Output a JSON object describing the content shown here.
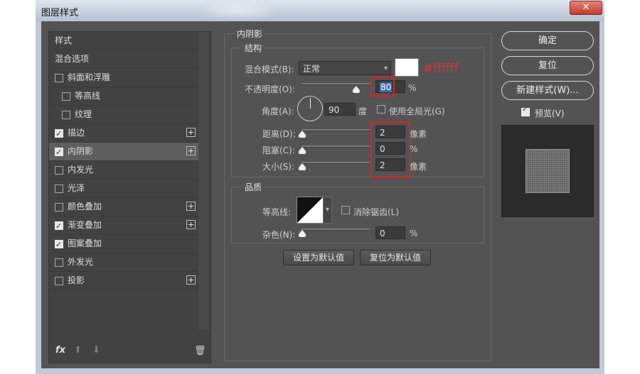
{
  "window": {
    "title": "图层样式",
    "close_glyph": "✕"
  },
  "style_list": {
    "items": [
      {
        "label": "样式",
        "kind": "top",
        "checkbox": false,
        "checked": false,
        "plus": false,
        "active": false
      },
      {
        "label": "混合选项",
        "kind": "top",
        "checkbox": false,
        "checked": false,
        "plus": false,
        "active": false
      },
      {
        "label": "斜面和浮雕",
        "kind": "item",
        "checkbox": true,
        "checked": false,
        "plus": false,
        "active": false
      },
      {
        "label": "等高线",
        "kind": "sub",
        "checkbox": true,
        "checked": false,
        "plus": false,
        "active": false
      },
      {
        "label": "纹理",
        "kind": "sub",
        "checkbox": true,
        "checked": false,
        "plus": false,
        "active": false
      },
      {
        "label": "描边",
        "kind": "item",
        "checkbox": true,
        "checked": true,
        "plus": true,
        "active": false
      },
      {
        "label": "内阴影",
        "kind": "item",
        "checkbox": true,
        "checked": true,
        "plus": true,
        "active": true
      },
      {
        "label": "内发光",
        "kind": "item",
        "checkbox": true,
        "checked": false,
        "plus": false,
        "active": false
      },
      {
        "label": "光泽",
        "kind": "item",
        "checkbox": true,
        "checked": false,
        "plus": false,
        "active": false
      },
      {
        "label": "颜色叠加",
        "kind": "item",
        "checkbox": true,
        "checked": false,
        "plus": true,
        "active": false
      },
      {
        "label": "渐变叠加",
        "kind": "item",
        "checkbox": true,
        "checked": true,
        "plus": true,
        "active": false
      },
      {
        "label": "图案叠加",
        "kind": "item",
        "checkbox": true,
        "checked": true,
        "plus": false,
        "active": false
      },
      {
        "label": "外发光",
        "kind": "item",
        "checkbox": true,
        "checked": false,
        "plus": false,
        "active": false
      },
      {
        "label": "投影",
        "kind": "item",
        "checkbox": true,
        "checked": false,
        "plus": true,
        "active": false
      }
    ],
    "footer": {
      "fx": "fx",
      "up": "⬆",
      "down": "⬇",
      "trash": "🗑"
    }
  },
  "inner_shadow": {
    "section_title": "内阴影",
    "structure": {
      "title": "结构",
      "blend_mode_label": "混合模式(B):",
      "blend_mode_value": "正常",
      "color_annotation": "#ffffff",
      "swatch_color": "#ffffff",
      "opacity_label": "不透明度(O):",
      "opacity_value": "80",
      "opacity_level": 0.8,
      "percent": "%",
      "angle_label": "角度(A):",
      "angle_value": "90",
      "degree": "度",
      "global_light_label": "使用全局光(G)",
      "global_light_checked": false,
      "distance_label": "距离(D):",
      "distance_value": "2",
      "distance_unit": "像素",
      "choke_label": "阻塞(C):",
      "choke_value": "0",
      "choke_unit": "%",
      "size_label": "大小(S):",
      "size_value": "2",
      "size_unit": "像素"
    },
    "quality": {
      "title": "品质",
      "contour_label": "等高线:",
      "anti_alias_label": "消除锯齿(L)",
      "anti_alias_checked": false,
      "noise_label": "杂色(N):",
      "noise_value": "0",
      "noise_unit": "%"
    },
    "make_default": "设置为默认值",
    "reset_default": "复位为默认值"
  },
  "right_panel": {
    "ok": "确定",
    "reset": "复位",
    "new_style": "新建样式(W)...",
    "preview_label": "预览(V)",
    "preview_checked": true
  },
  "colors": {
    "accent_red": "#e02020",
    "dialog_bg": "#535353"
  }
}
